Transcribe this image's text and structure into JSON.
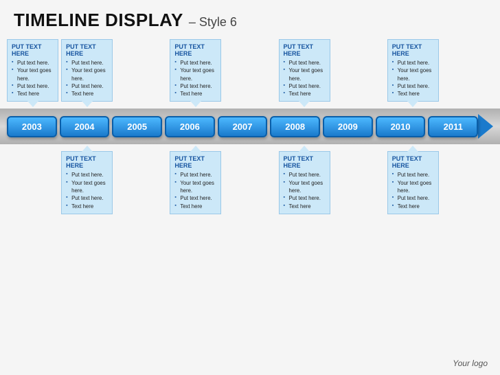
{
  "header": {
    "title_main": "TIMELINE DISPLAY",
    "title_sep": "–",
    "title_sub": "Style  6"
  },
  "years": [
    "2003",
    "2004",
    "2005",
    "2006",
    "2007",
    "2008",
    "2009",
    "2010",
    "2011"
  ],
  "top_callouts": [
    {
      "title": "PUT TEXT HERE",
      "items": [
        "Put text here.",
        "Your text goes here.",
        "Put text here.",
        "Text here"
      ]
    },
    {
      "title": "PUT TEXT HERE",
      "items": [
        "Put text here.",
        "Your text goes here.",
        "Put text here.",
        "Text here"
      ]
    },
    null,
    {
      "title": "PUT TEXT HERE",
      "items": [
        "Put text here.",
        "Your text goes here.",
        "Put text here.",
        "Text here"
      ]
    },
    null,
    {
      "title": "PUT TEXT HERE",
      "items": [
        "Put text here.",
        "Your text goes here.",
        "Put text here.",
        "Text here"
      ]
    },
    null,
    {
      "title": "PUT TEXT HERE",
      "items": [
        "Put text here.",
        "Your text goes here.",
        "Put text here.",
        "Text here"
      ]
    },
    null
  ],
  "bottom_callouts": [
    null,
    {
      "title": "PUT TEXT HERE",
      "items": [
        "Put text here.",
        "Your text goes here.",
        "Put text here.",
        "Text here"
      ]
    },
    null,
    {
      "title": "PUT TEXT HERE",
      "items": [
        "Put text here.",
        "Your text goes here.",
        "Put text here.",
        "Text here"
      ]
    },
    null,
    {
      "title": "PUT TEXT HERE",
      "items": [
        "Put text here.",
        "Your text goes here.",
        "Put text here.",
        "Text here"
      ]
    },
    null,
    {
      "title": "PUT TEXT HERE",
      "items": [
        "Put text here.",
        "Your text goes here.",
        "Put text here.",
        "Text here"
      ]
    },
    null
  ],
  "logo": "Your logo",
  "colors": {
    "accent": "#1a7acc",
    "callout_bg": "#cce8f8",
    "callout_border": "#9ac8e8",
    "title_blue": "#1755a0"
  }
}
